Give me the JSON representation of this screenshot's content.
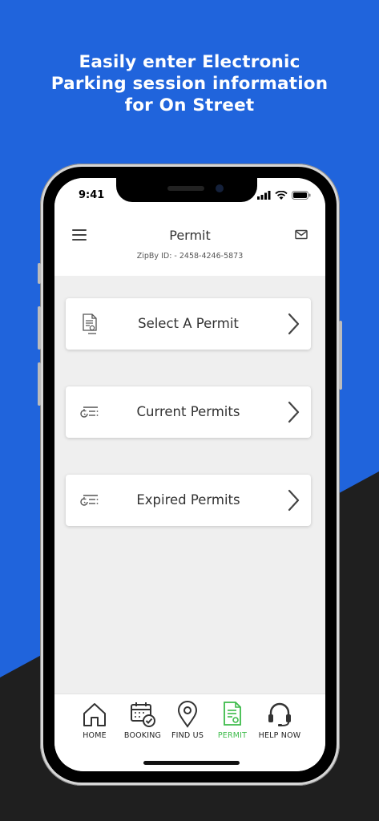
{
  "promo": {
    "headline": "Easily enter Electronic\nParking session information\nfor On Street"
  },
  "status_bar": {
    "time": "9:41"
  },
  "header": {
    "title": "Permit",
    "zipby_id": "ZipBy ID: - 2458-4246-5873",
    "menu_icon": "hamburger-menu-icon",
    "mail_icon": "mail-icon"
  },
  "menu": [
    {
      "label": "Select A Permit",
      "icon": "permit-document-icon"
    },
    {
      "label": "Current Permits",
      "icon": "permit-list-icon"
    },
    {
      "label": "Expired Permits",
      "icon": "permit-list-icon"
    }
  ],
  "tabbar": {
    "tabs": [
      {
        "label": "HOME",
        "icon": "home-icon"
      },
      {
        "label": "BOOKING",
        "icon": "calendar-check-icon"
      },
      {
        "label": "FIND US",
        "icon": "location-pin-icon"
      },
      {
        "label": "PERMIT",
        "icon": "permit-document-icon",
        "active": true
      },
      {
        "label": "HELP NOW",
        "icon": "headset-icon"
      }
    ]
  },
  "colors": {
    "brand_blue": "#2064dc",
    "dark_band": "#1f1f1f",
    "active_tab": "#3dbb4a"
  }
}
